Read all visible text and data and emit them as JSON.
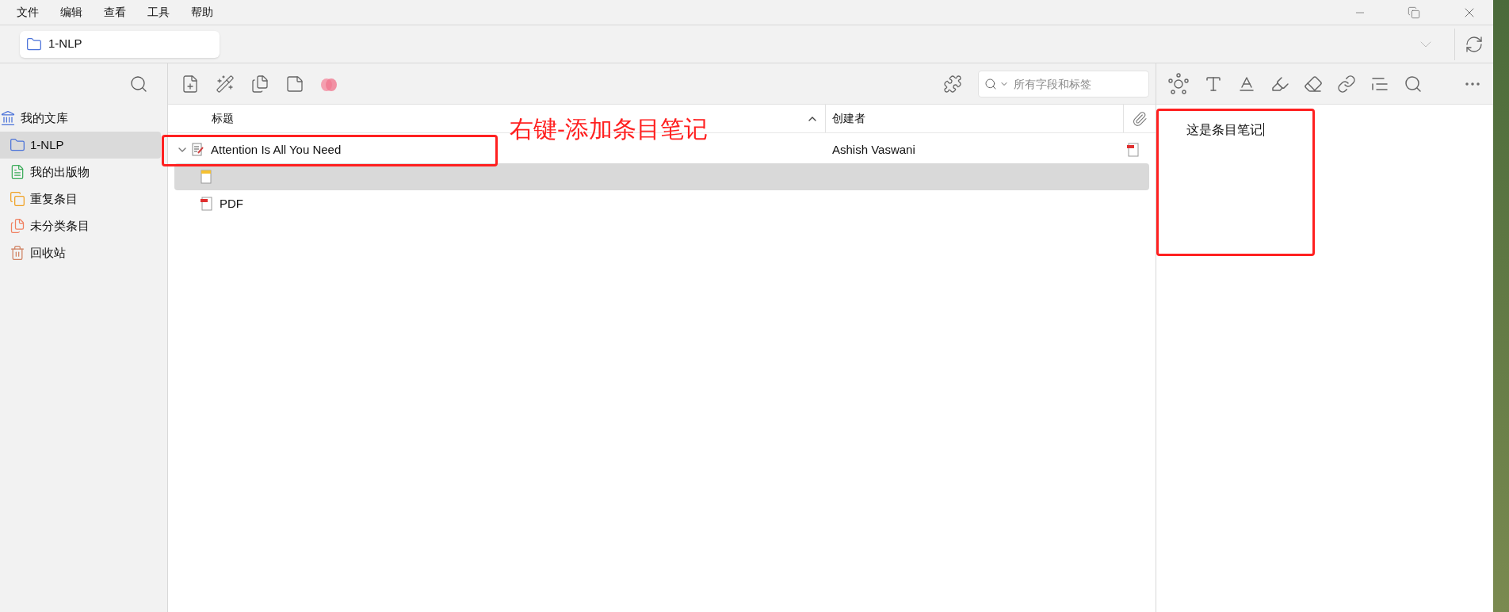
{
  "menu": [
    "文件",
    "编辑",
    "查看",
    "工具",
    "帮助"
  ],
  "tab": {
    "label": "1-NLP"
  },
  "sidebar": {
    "items": [
      {
        "label": "我的文库",
        "kind": "library",
        "selected": false,
        "children": [
          {
            "label": "1-NLP",
            "kind": "folder",
            "selected": true
          },
          {
            "label": "我的出版物",
            "kind": "publications",
            "selected": false
          },
          {
            "label": "重复条目",
            "kind": "duplicates",
            "selected": false
          },
          {
            "label": "未分类条目",
            "kind": "unfiled",
            "selected": false
          },
          {
            "label": "回收站",
            "kind": "trash",
            "selected": false
          }
        ]
      }
    ]
  },
  "search": {
    "placeholder": "所有字段和标签"
  },
  "table": {
    "columns": [
      "标题",
      "创建者"
    ],
    "rows": [
      {
        "kind": "item",
        "title": "Attention Is All You Need",
        "creator": "Ashish Vaswani",
        "expanded": true,
        "selected": false,
        "children": [
          {
            "kind": "note",
            "selected": true
          },
          {
            "kind": "pdf",
            "title": "PDF",
            "selected": false
          }
        ]
      }
    ]
  },
  "note_editor": {
    "text": "这是条目笔记"
  },
  "annotation": {
    "text": "右键-添加条目笔记"
  }
}
